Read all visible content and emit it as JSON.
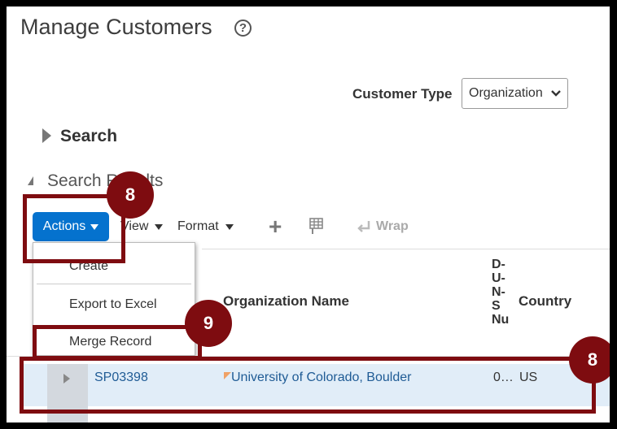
{
  "page": {
    "title": "Manage Customers",
    "help_glyph": "?"
  },
  "customer_type": {
    "label": "Customer Type",
    "value": "Organization"
  },
  "search_section": {
    "label": "Search"
  },
  "results_section": {
    "label": "Search Results"
  },
  "toolbar": {
    "actions_label": "Actions",
    "view_label": "View",
    "format_label": "Format",
    "wrap_label": "Wrap"
  },
  "actions_menu": {
    "items": [
      {
        "label": "Create"
      },
      {
        "label": "Export to Excel"
      },
      {
        "label": "Merge Record"
      }
    ]
  },
  "table": {
    "headers": {
      "org_name": "Organization Name",
      "duns": "D-\nU-\nN-\nS\nNu",
      "country": "Country"
    },
    "rows": [
      {
        "id": "SP03398",
        "org_name": "University of Colorado, Boulder",
        "duns": "0…",
        "country": "US"
      }
    ]
  },
  "annotations": {
    "badge_actions": "8",
    "badge_merge": "9",
    "badge_row": "8",
    "highlight_color": "#7e0c10"
  },
  "colors": {
    "accent": "#0572ce",
    "link": "#1f5b95",
    "row_selected": "#e1edf8"
  }
}
